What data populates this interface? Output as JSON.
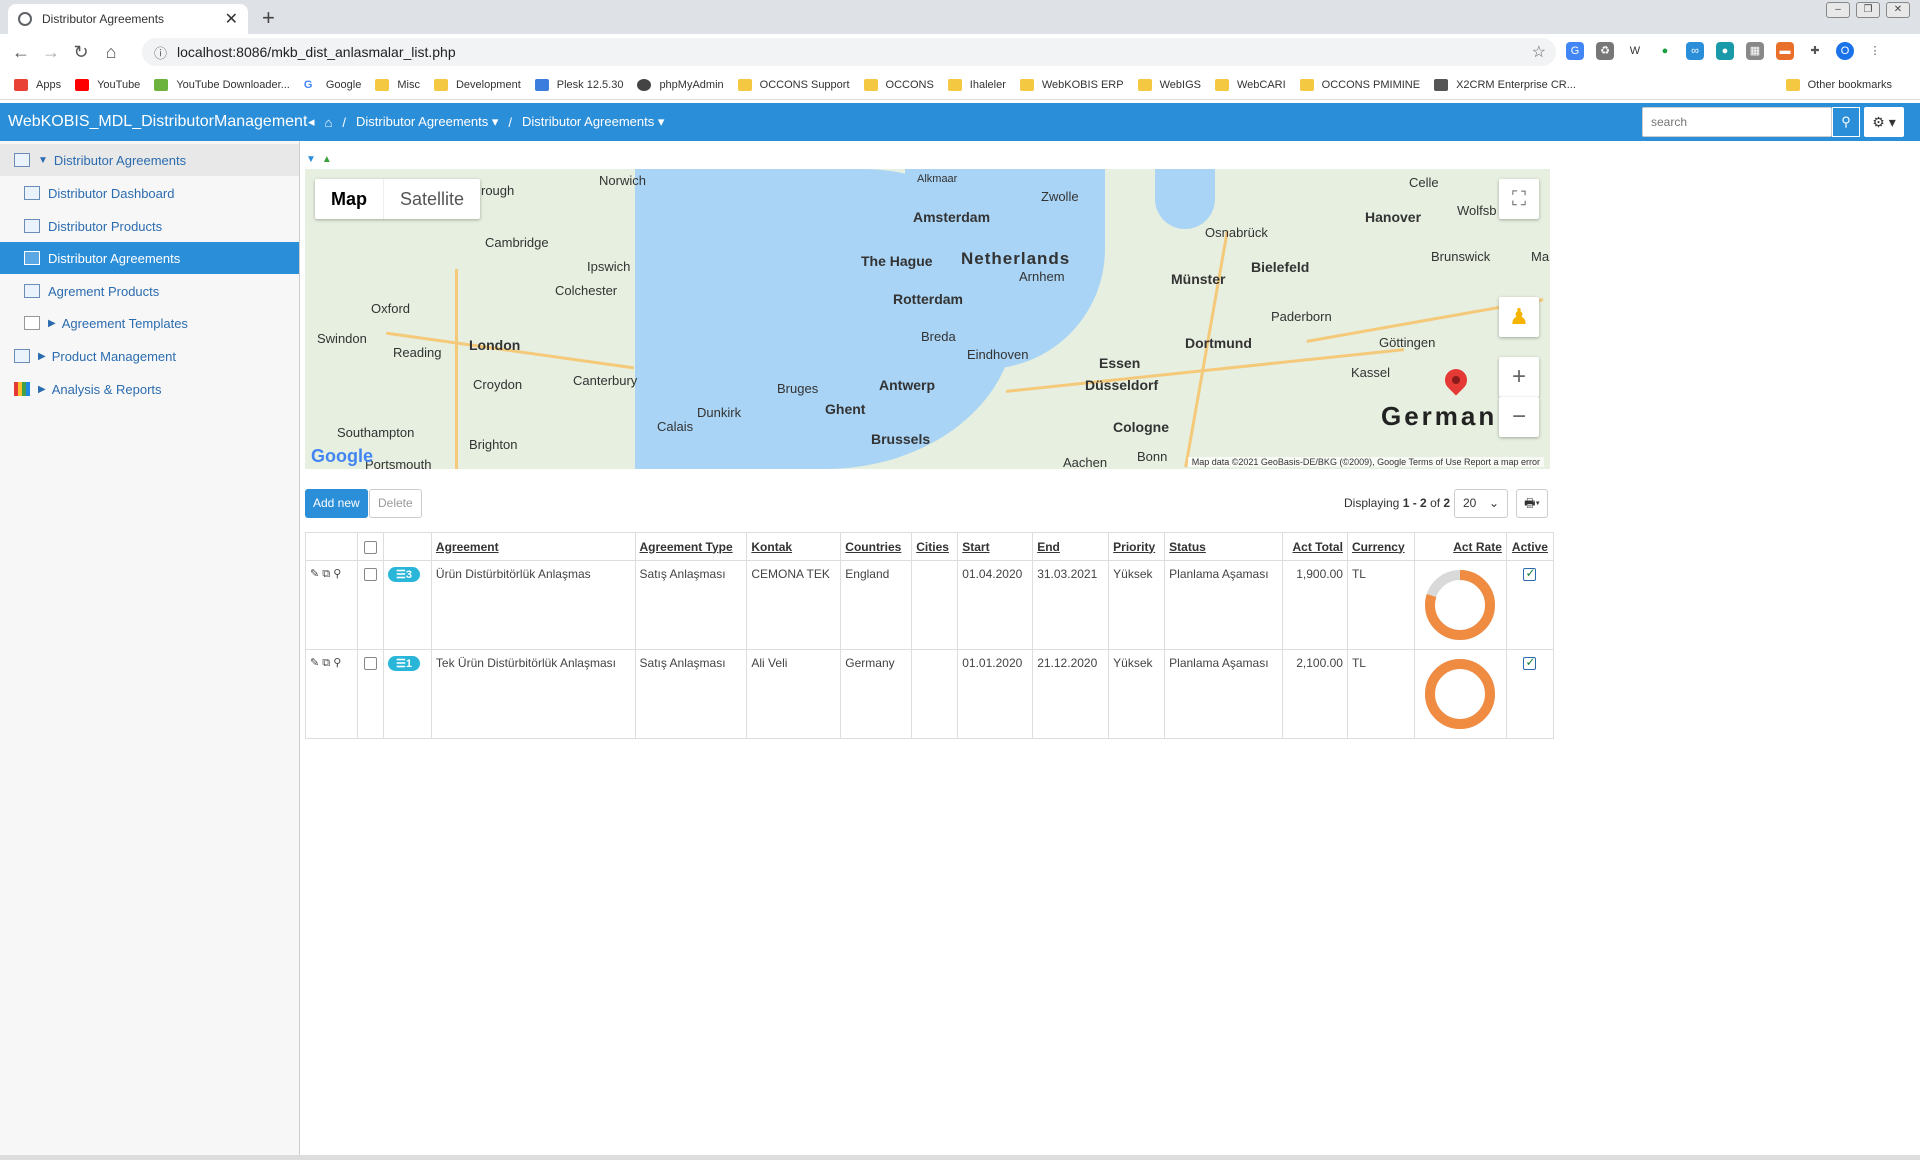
{
  "browser": {
    "tab_title": "Distributor Agreements",
    "url": "localhost:8086/mkb_dist_anlasmalar_list.php",
    "bookmarks": [
      "Apps",
      "YouTube",
      "YouTube Downloader...",
      "Google",
      "Misc",
      "Development",
      "Plesk 12.5.30",
      "phpMyAdmin",
      "OCCONS Support",
      "OCCONS",
      "Ihaleler",
      "WebKOBIS ERP",
      "WebIGS",
      "WebCARI",
      "OCCONS PMIMINE",
      "X2CRM Enterprise CR..."
    ],
    "other_bookmarks": "Other bookmarks",
    "profile_initial": "O"
  },
  "app": {
    "name": "WebKOBIS_MDL_DistributorManagement",
    "breadcrumb": [
      "Distributor Agreements",
      "Distributor Agreements"
    ],
    "search_placeholder": "search"
  },
  "sidebar": {
    "items": [
      {
        "label": "Distributor Agreements"
      },
      {
        "label": "Distributor Dashboard"
      },
      {
        "label": "Distributor Products"
      },
      {
        "label": "Distributor Agreements"
      },
      {
        "label": "Agrement Products"
      },
      {
        "label": "Agreement Templates"
      },
      {
        "label": "Product Management"
      },
      {
        "label": "Analysis & Reports"
      }
    ]
  },
  "map": {
    "type_map": "Map",
    "type_satellite": "Satellite",
    "labels": [
      "Norwich",
      "Cambridge",
      "Ipswich",
      "Colchester",
      "Oxford",
      "London",
      "Reading",
      "Swindon",
      "Croydon",
      "Canterbury",
      "Southampton",
      "Brighton",
      "Portsmouth",
      "Calais",
      "Dunkirk",
      "Bruges",
      "Ghent",
      "Antwerp",
      "Brussels",
      "Amsterdam",
      "The Hague",
      "Rotterdam",
      "Breda",
      "Eindhoven",
      "Arnhem",
      "Zwolle",
      "Alkmaar",
      "Netherlands",
      "Osnabrück",
      "Münster",
      "Bielefeld",
      "Dortmund",
      "Essen",
      "Düsseldorf",
      "Cologne",
      "Aachen",
      "Bonn",
      "Paderborn",
      "Göttingen",
      "Kassel",
      "Hanover",
      "Celle",
      "Wolfsb",
      "Brunswick",
      "Ma",
      "rough",
      "German"
    ],
    "google": "Google",
    "attribution": "Map data ©2021 GeoBasis-DE/BKG (©2009), Google   Terms of Use   Report a map error"
  },
  "toolbar": {
    "add_new": "Add new",
    "delete": "Delete",
    "displaying_prefix": "Displaying",
    "displaying_range": "1 - 2",
    "displaying_of": "of",
    "displaying_total": "2",
    "page_size": "20"
  },
  "grid": {
    "columns": [
      "Agreement",
      "Agreement Type",
      "Kontak",
      "Countries",
      "Cities",
      "Start",
      "End",
      "Priority",
      "Status",
      "Act Total",
      "Currency",
      "Act Rate",
      "Active"
    ],
    "rows": [
      {
        "badge": "3",
        "agreement": "Ürün Distürbitörlük Anlaşmas",
        "type": "Satış Anlaşması",
        "kontak": "CEMONA TEK",
        "countries": "England",
        "cities": "",
        "start": "01.04.2020",
        "end": "31.03.2021",
        "priority": "Yüksek",
        "status": "Planlama Aşaması",
        "act_total": "1,900.00",
        "currency": "TL",
        "act_rate": 0.8,
        "active": true
      },
      {
        "badge": "1",
        "agreement": "Tek Ürün Distürbitörlük Anlaşması",
        "type": "Satış Anlaşması",
        "kontak": "Ali Veli",
        "countries": "Germany",
        "cities": "",
        "start": "01.01.2020",
        "end": "21.12.2020",
        "priority": "Yüksek",
        "status": "Planlama Aşaması",
        "act_total": "2,100.00",
        "currency": "TL",
        "act_rate": 1.0,
        "active": true
      }
    ]
  },
  "colors": {
    "accent": "#2b8ed8",
    "donut": "#f08c42",
    "donut_bg": "#d9d9d9"
  }
}
